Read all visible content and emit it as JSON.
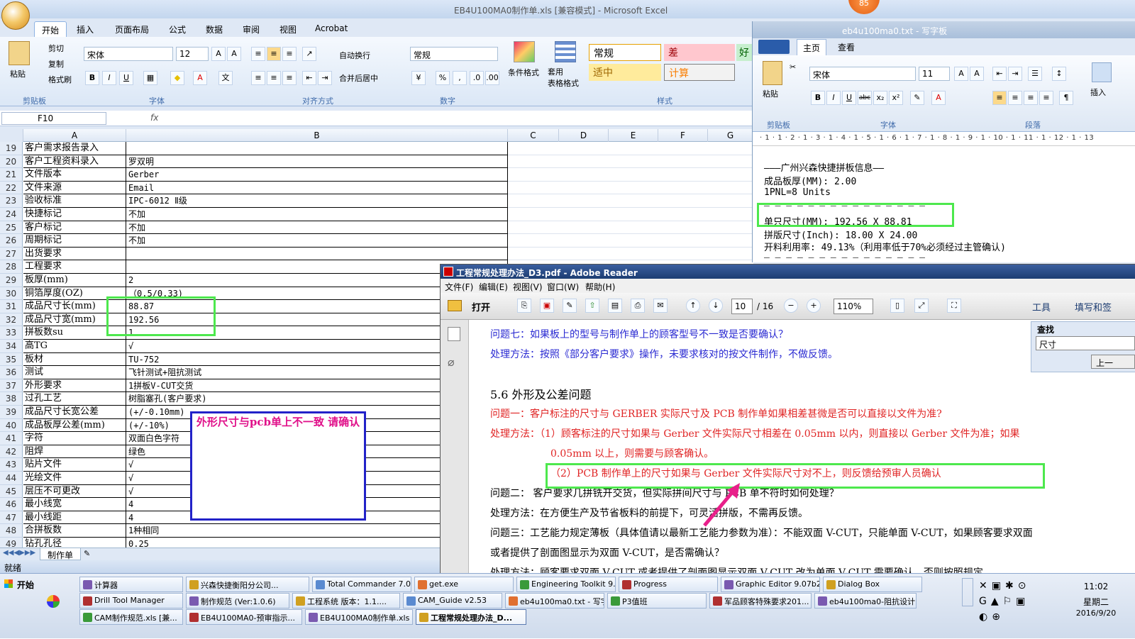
{
  "excel": {
    "title": "EB4U100MA0制作单.xls  [兼容模式] - Microsoft Excel",
    "tabs": [
      "开始",
      "插入",
      "页面布局",
      "公式",
      "数据",
      "审阅",
      "视图",
      "Acrobat"
    ],
    "clipboard": {
      "paste": "粘贴",
      "cut": "剪切",
      "copy": "复制",
      "format_painter": "格式刷",
      "group": "剪贴板"
    },
    "font": {
      "name": "宋体",
      "size": "12",
      "group": "字体"
    },
    "alignment": {
      "wrap": "自动换行",
      "merge": "合并后居中",
      "group": "对齐方式"
    },
    "number": {
      "format": "常规",
      "group": "数字"
    },
    "styles": {
      "cond": "条件格式",
      "table": "套用\n表格格式",
      "normal": "常规",
      "bad": "差",
      "good": "好",
      "neutral": "适中",
      "calc": "计算",
      "group": "样式"
    },
    "namebox": "F10",
    "fx": "fx",
    "columns": [
      "A",
      "B",
      "C",
      "D",
      "E",
      "F",
      "G"
    ],
    "rows": [
      {
        "n": "19",
        "a": "客户需求报告录入",
        "b": ""
      },
      {
        "n": "20",
        "a": "客户工程资料录入",
        "b": "罗双明"
      },
      {
        "n": "21",
        "a": "文件版本",
        "b": "Gerber"
      },
      {
        "n": "22",
        "a": "文件来源",
        "b": "Email"
      },
      {
        "n": "23",
        "a": "验收标准",
        "b": "IPC-6012 Ⅱ级"
      },
      {
        "n": "24",
        "a": "快捷标记",
        "b": "不加"
      },
      {
        "n": "25",
        "a": "客户标记",
        "b": "不加"
      },
      {
        "n": "26",
        "a": "周期标记",
        "b": "不加"
      },
      {
        "n": "27",
        "a": "出货要求",
        "b": ""
      },
      {
        "n": "28",
        "a": "工程要求",
        "b": ""
      },
      {
        "n": "29",
        "a": "板厚(mm)",
        "b": "2"
      },
      {
        "n": "30",
        "a": "铜箔厚度(OZ)",
        "b": "（0.5/0.33)"
      },
      {
        "n": "31",
        "a": "成品尺寸长(mm)",
        "b": "88.87"
      },
      {
        "n": "32",
        "a": "成品尺寸宽(mm)",
        "b": "192.56"
      },
      {
        "n": "33",
        "a": "拼板数su",
        "b": "1"
      },
      {
        "n": "34",
        "a": "高TG",
        "b": "√"
      },
      {
        "n": "35",
        "a": "板材",
        "b": "TU-752"
      },
      {
        "n": "36",
        "a": "测试",
        "b": "飞针测试+阻抗测试"
      },
      {
        "n": "37",
        "a": "外形要求",
        "b": "1拼板V-CUT交货"
      },
      {
        "n": "38",
        "a": "过孔工艺",
        "b": "树脂塞孔(客户要求)"
      },
      {
        "n": "39",
        "a": "成品尺寸长宽公差",
        "b": "(+/-0.10mm)"
      },
      {
        "n": "40",
        "a": "成品板厚公差(mm)",
        "b": "(+/-10%)"
      },
      {
        "n": "41",
        "a": "字符",
        "b": "双面白色字符"
      },
      {
        "n": "42",
        "a": "阻焊",
        "b": "绿色"
      },
      {
        "n": "43",
        "a": "贴片文件",
        "b": "√"
      },
      {
        "n": "44",
        "a": "光绘文件",
        "b": "√"
      },
      {
        "n": "45",
        "a": "层压不可更改",
        "b": "√"
      },
      {
        "n": "46",
        "a": "最小线宽",
        "b": "4"
      },
      {
        "n": "47",
        "a": "最小线距",
        "b": "4"
      },
      {
        "n": "48",
        "a": "合拼板数",
        "b": "1种相同"
      },
      {
        "n": "49",
        "a": "钻孔孔径",
        "b": "0.25"
      }
    ],
    "sheet_tab": "制作单",
    "status": "就绪",
    "note": "外形尺寸与pcb单上不一致 请确认"
  },
  "wordpad": {
    "title": "eb4u100ma0.txt - 写字板",
    "tabs": [
      "主页",
      "查看"
    ],
    "font": "宋体",
    "size": "11",
    "groups": {
      "clipboard": "剪贴板",
      "font": "字体",
      "paragraph": "段落",
      "insert": "插入",
      "paste": "粘贴"
    },
    "ruler": "· 1 · 1 · 2 · 1 · 3 · 1 · 4 · 1 · 5 · 1 · 6 · 1 · 7 · 1 · 8 · 1 · 9 · 1 · 10 · 1 · 11 · 1 · 12 · 1 · 13",
    "lines": [
      "———广州兴森快捷拼板信息——",
      "成品板厚(MM): 2.00",
      "1PNL=8 Units",
      "— — — — — — — — — — — — — — —",
      "单只尺寸(MM): 192.56 X 88.81",
      "拼版尺寸(Inch): 18.00 X 24.00",
      "开料利用率: 49.13%（利用率低于70%必须经过主管确认)",
      "— — — — — — — — — — — — — — —"
    ]
  },
  "adobe": {
    "title": "工程常规处理办法_D3.pdf - Adobe Reader",
    "menu": [
      "文件(F)",
      "编辑(E)",
      "视图(V)",
      "窗口(W)",
      "帮助(H)"
    ],
    "open": "打开",
    "page": "10",
    "pages": "/ 16",
    "zoom": "110%",
    "tools": "工具",
    "sign": "填写和签",
    "find_label": "查找",
    "find_value": "尺寸",
    "find_btn": "上一",
    "lines": [
      {
        "t": "问题七：如果板上的型号与制作单上的顾客型号不一致是否要确认？",
        "c": "blue"
      },
      {
        "t": "处理方法：按照《部分客户要求》操作，未要求核对的按文件制作，不做反馈。",
        "c": "blue"
      },
      {
        "t": "5.6 外形及公差问题",
        "c": "black"
      },
      {
        "t": "问题一：客户标注的尺寸与 GERBER 实际尺寸及 PCB 制作单如果相差甚微是否可以直接以文件为准?",
        "c": "red"
      },
      {
        "t": "处理方法：（1）顾客标注的尺寸如果与 Gerber 文件实际尺寸相差在 0.05mm 以内，则直接以 Gerber 文件为准；如果",
        "c": "red"
      },
      {
        "t": "0.05mm 以上，则需要与顾客确认。",
        "c": "red"
      },
      {
        "t": "（2）PCB 制作单上的尺寸如果与 Gerber 文件实际尺寸对不上，则反馈给预审人员确认",
        "c": "red"
      },
      {
        "t": "问题二： 客户要求几拼铣开交货，但实际拼间尺寸与 PCB 单不符时如何处理？",
        "c": "black"
      },
      {
        "t": "处理方法：在方便生产及节省板料的前提下，可灵活拼版，不需再反馈。",
        "c": "black"
      },
      {
        "t": "问题三：工艺能力规定薄板（具体值请以最新工艺能力参数为准）：不能双面 V-CUT，只能单面 V-CUT，如果顾客要求双面",
        "c": "black"
      },
      {
        "t": "或者提供了剖面图显示为双面 V-CUT，是否需确认？",
        "c": "black"
      },
      {
        "t": "处理方法：顾客要求双面 V-CUT 或者提供了剖面图显示双面 V-CUT 改为单面 V-CUT 需要确认，否则按照规定",
        "c": "black"
      }
    ]
  },
  "taskbar": {
    "start": "开始",
    "row1": [
      "计算器",
      "兴森快捷衡阳分公司...",
      "Total Commander 7.0 ...",
      "get.exe",
      "Engineering Toolkit 9.0...",
      "Progress",
      "Graphic Editor 9.07b2 (...",
      "Dialog Box"
    ],
    "row2": [
      "Drill Tool Manager",
      "制作规范 (Ver:1.0.6)",
      "工程系统  版本：1.1....",
      "CAM_Guide v2.53",
      "eb4u100ma0.txt - 写字板",
      "P3值班",
      "军品顾客特殊要求201...",
      "eb4u100ma0-阻抗设计..."
    ],
    "row3": [
      "CAM制作规范.xls [兼...",
      "EB4U100MA0-预审指示...",
      "EB4U100MA0制作单.xls ...",
      "工程常规处理办法_D..."
    ],
    "time": "11:02",
    "weekday": "星期二",
    "date": "2016/9/20",
    "badge": "85"
  }
}
